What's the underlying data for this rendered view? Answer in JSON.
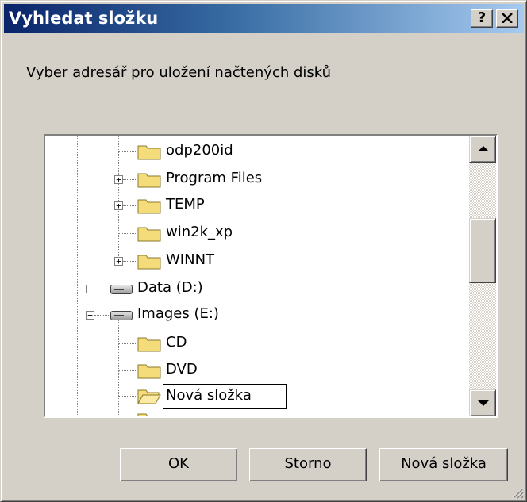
{
  "window": {
    "title": "Vyhledat složku",
    "help_label": "?",
    "close_label": "✕"
  },
  "prompt": "Vyber adresář pro uložení načtených disků",
  "tree": {
    "items": [
      {
        "label": "odp200id",
        "icon": "folder-icon",
        "expandable": false
      },
      {
        "label": "Program Files",
        "icon": "folder-icon",
        "expandable": true
      },
      {
        "label": "TEMP",
        "icon": "folder-icon",
        "expandable": true
      },
      {
        "label": "win2k_xp",
        "icon": "folder-icon",
        "expandable": false
      },
      {
        "label": "WINNT",
        "icon": "folder-icon",
        "expandable": true
      },
      {
        "label": "Data (D:)",
        "icon": "drive-icon",
        "expandable": true,
        "expanded": false
      },
      {
        "label": "Images (E:)",
        "icon": "drive-icon",
        "expandable": true,
        "expanded": true
      },
      {
        "label": "CD",
        "icon": "folder-icon",
        "expandable": false
      },
      {
        "label": "DVD",
        "icon": "folder-icon",
        "expandable": false
      },
      {
        "label": "Nová složka",
        "icon": "folder-open-icon",
        "expandable": false,
        "editing": true
      }
    ],
    "expander_plus": "+",
    "expander_minus": "−"
  },
  "buttons": {
    "ok": "OK",
    "cancel": "Storno",
    "new_folder": "Nová složka"
  },
  "colors": {
    "folder": "#f5dc7a",
    "title_start": "#0a246a",
    "title_end": "#a6caf0",
    "face": "#d4d0c8"
  }
}
